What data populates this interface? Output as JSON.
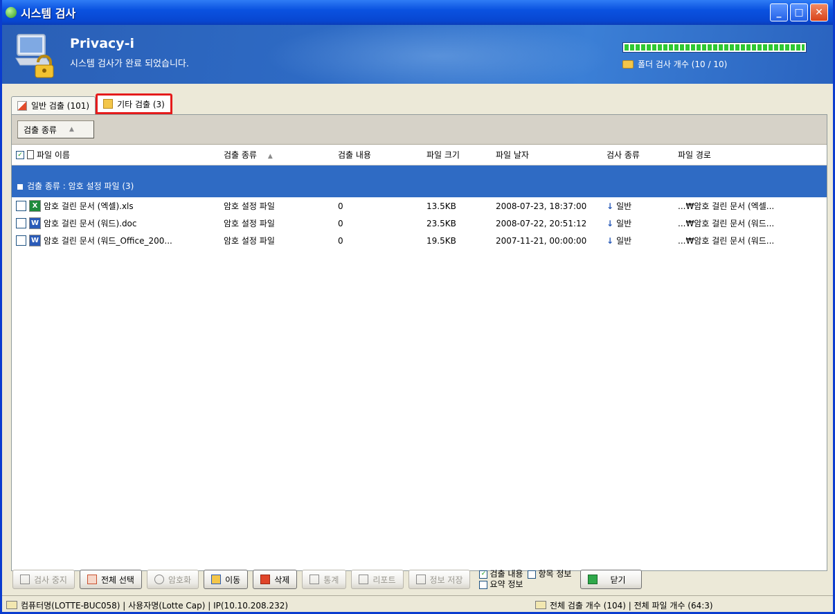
{
  "window": {
    "title": "시스템 검사"
  },
  "banner": {
    "product": "Privacy-i",
    "message": "시스템 검사가 완료 되었습니다.",
    "progress": 1.0,
    "folder_count": "폴더 검사 개수 (10 / 10)"
  },
  "tabs": [
    {
      "label": "일반 검출 (101)"
    },
    {
      "label": "기타 검출 (3)"
    }
  ],
  "group_chip": {
    "label": "검출 종류"
  },
  "columns": [
    "파일 이름",
    "검출 종류",
    "검출 내용",
    "파일 크기",
    "파일 날자",
    "검사 종류",
    "파일 경로"
  ],
  "group": {
    "label": "검출 종류 : 암호 설정 파일 (3)"
  },
  "rows": [
    {
      "icon": "excel-icon",
      "name": "암호 걸린 문서 (엑셀).xls",
      "type": "암호 설정 파일",
      "content": "0",
      "size": "13.5KB",
      "date": "2008-07-23, 18:37:00",
      "scan": "일반",
      "path": "...₩암호 걸린 문서 (엑셀..."
    },
    {
      "icon": "word-icon",
      "name": "암호 걸린 문서 (워드).doc",
      "type": "암호 설정 파일",
      "content": "0",
      "size": "23.5KB",
      "date": "2008-07-22, 20:51:12",
      "scan": "일반",
      "path": "...₩암호 걸린 문서 (워드..."
    },
    {
      "icon": "word-icon",
      "name": "암호 걸린 문서 (워드_Office_200...",
      "type": "암호 설정 파일",
      "content": "0",
      "size": "19.5KB",
      "date": "2007-11-21, 00:00:00",
      "scan": "일반",
      "path": "...₩암호 걸린 문서 (워드..."
    }
  ],
  "buttons": {
    "stop": "검사 중지",
    "select_all": "전체 선택",
    "encrypt": "암호화",
    "move": "이동",
    "delete": "삭제",
    "stats": "통계",
    "report": "리포트",
    "save_info": "정보 저장",
    "close": "닫기"
  },
  "options": {
    "detect_content": "검출 내용",
    "item_info": "항목 정보",
    "summary_info": "요약 정보"
  },
  "status": {
    "left": "컴퓨터명(LOTTE-BUC058) | 사용자명(Lotte Cap) | IP(10.10.208.232)",
    "right": "전체 검출 개수 (104) | 전체 파일 개수 (64:3)"
  },
  "colors": {
    "titlebar": "#0a52e0",
    "group_row": "#2f6bc4",
    "tab_highlight": "#e51b1b"
  }
}
